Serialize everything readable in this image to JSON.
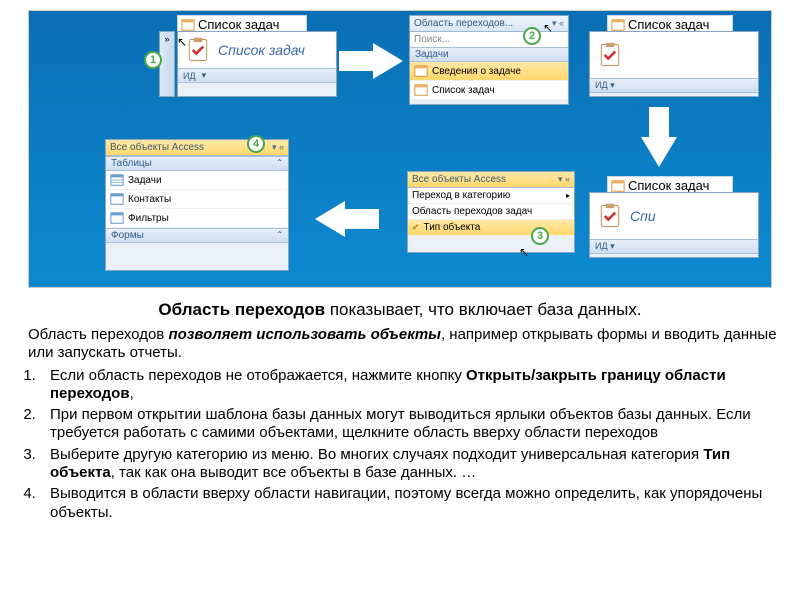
{
  "badges": [
    "1",
    "2",
    "3",
    "4"
  ],
  "p1": {
    "tabtitle": "Список задач",
    "bigtitle": "Список задач",
    "footer": "ИД"
  },
  "p2": {
    "tabtitle": "Область переходов...",
    "search": "Поиск...",
    "sec": "Задачи",
    "row1": "Сведения о задаче",
    "row2": "Список задач"
  },
  "p2b": {
    "tabtitle": "Список задач",
    "footer": "ИД"
  },
  "p3": {
    "hdr": "Все объекты Access",
    "opt1": "Переход в категорию",
    "opt2": "Область переходов задач",
    "opt3": "Тип объекта"
  },
  "p3b": {
    "tabtitle": "Список задач",
    "bigtitle": "Спи",
    "footer": "ИД"
  },
  "p4": {
    "hdr": "Все объекты Access",
    "sec1": "Таблицы",
    "r1": "Задачи",
    "r2": "Контакты",
    "r3": "Фильтры",
    "sec2": "Формы"
  },
  "text": {
    "title_bold": "Область переходов",
    "title_rest": " показывает, что включает база данных.",
    "para_pre": "Область переходов ",
    "para_em": "позволяет использовать объекты",
    "para_post": ", например открывать формы и вводить данные или запускать отчеты.",
    "li1_a": "Если область переходов не отображается, нажмите кнопку ",
    "li1_b": "Открыть/закрыть границу области переходов",
    "li1_c": ",",
    "li2": "При первом открытии шаблона базы данных могут выводиться ярлыки объектов базы данных. Если требуется работать с самими объектами, щелкните область вверху области переходов",
    "li3_a": "Выберите другую категорию из меню. Во многих случаях подходит универсальная категория ",
    "li3_b": "Тип объекта",
    "li3_c": ", так как она выводит все объекты в базе данных. …",
    "li4": "Выводится в области вверху области навигации, поэтому всегда можно определить, как упорядочены объекты."
  }
}
